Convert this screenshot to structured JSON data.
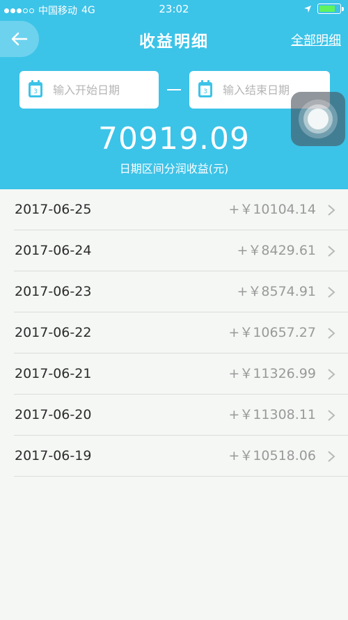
{
  "status_bar": {
    "carrier": "中国移动",
    "network": "4G",
    "time": "23:02"
  },
  "header": {
    "title": "收益明细",
    "all_details_label": "全部明细"
  },
  "date_range": {
    "start_placeholder": "输入开始日期",
    "end_placeholder": "输入结束日期",
    "calendar_icon_text": "3"
  },
  "summary": {
    "total": "70919.09",
    "label": "日期区间分润收益(元)"
  },
  "records": [
    {
      "date": "2017-06-25",
      "amount": "+￥10104.14"
    },
    {
      "date": "2017-06-24",
      "amount": "+￥8429.61"
    },
    {
      "date": "2017-06-23",
      "amount": "+￥8574.91"
    },
    {
      "date": "2017-06-22",
      "amount": "+￥10657.27"
    },
    {
      "date": "2017-06-21",
      "amount": "+￥11326.99"
    },
    {
      "date": "2017-06-20",
      "amount": "+￥11308.11"
    },
    {
      "date": "2017-06-19",
      "amount": "+￥10518.06"
    }
  ],
  "colors": {
    "header_bg": "#3cc3e8",
    "page_bg": "#f4f7f4",
    "battery": "#5ff35f"
  }
}
